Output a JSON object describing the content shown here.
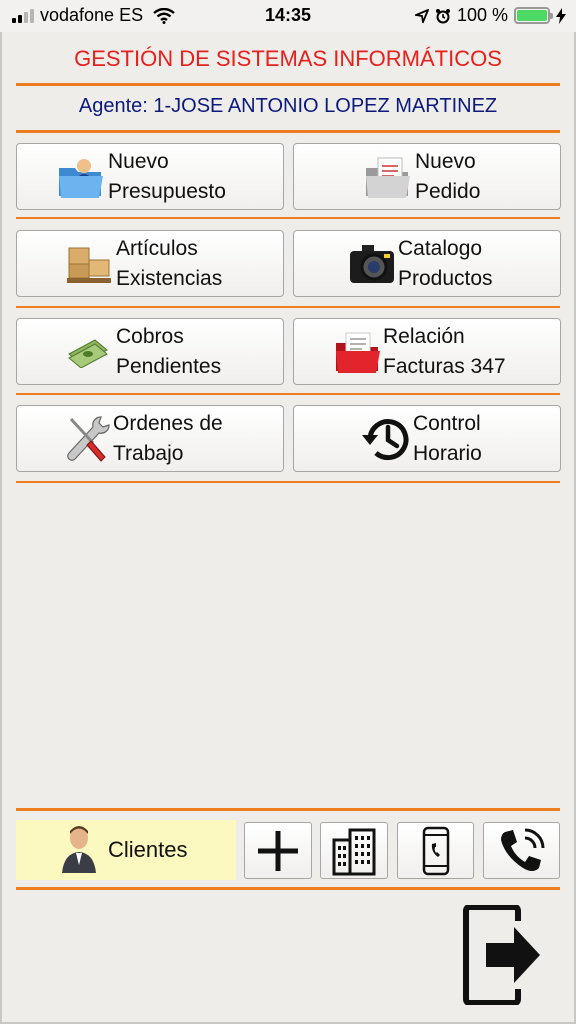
{
  "status_bar": {
    "carrier": "vodafone ES",
    "time": "14:35",
    "battery": "100 %"
  },
  "header": {
    "title": "GESTIÓN DE SISTEMAS INFORMÁTICOS",
    "agent": "Agente: 1-JOSE ANTONIO LOPEZ MARTINEZ"
  },
  "menu": {
    "nuevo_presupuesto": "Nuevo\nPresupuesto",
    "nuevo_pedido": "Nuevo\nPedido",
    "articulos_existencias": "Artículos\nExistencias",
    "catalogo_productos": "Catalogo\nProductos",
    "cobros_pendientes": "Cobros\nPendientes",
    "relacion_facturas": "Relación\nFacturas 347",
    "ordenes_trabajo": "Ordenes de\nTrabajo",
    "control_horario": "Control\nHorario"
  },
  "bottom": {
    "clientes_label": "Clientes"
  },
  "icons": [
    "folder-user-icon",
    "folder-document-icon",
    "boxes-icon",
    "camera-icon",
    "money-icon",
    "red-folder-icon",
    "wrench-screwdriver-icon",
    "history-clock-icon",
    "user-icon",
    "plus-icon",
    "building-icon",
    "mobile-phone-icon",
    "phone-icon",
    "exit-icon"
  ],
  "colors": {
    "title": "#e8201c",
    "agent": "#0c1a7d",
    "separator": "#ee7d1e",
    "clientes_bg": "#fbf8c0"
  }
}
